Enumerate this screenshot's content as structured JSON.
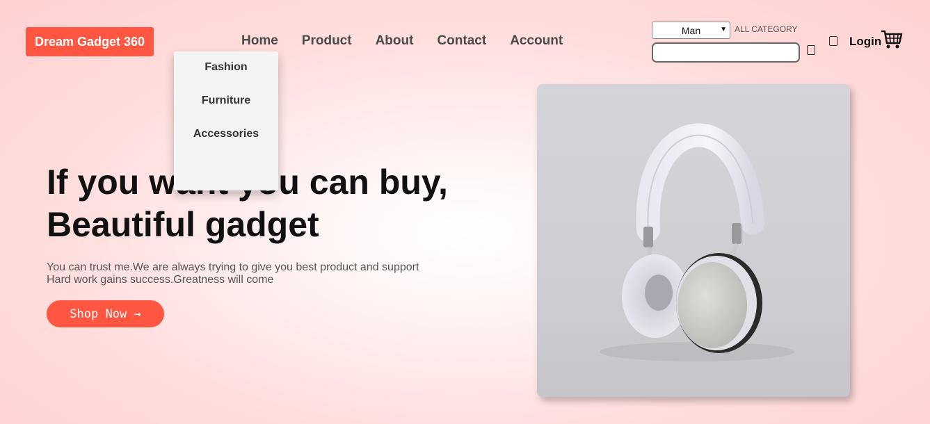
{
  "brand": {
    "name": "Dream Gadget 360",
    "color": "#ff5641"
  },
  "nav": {
    "items": [
      {
        "label": "Home"
      },
      {
        "label": "Product"
      },
      {
        "label": "About"
      },
      {
        "label": "Contact"
      },
      {
        "label": "Account"
      }
    ]
  },
  "dropdown": {
    "items": [
      {
        "label": "Fashion"
      },
      {
        "label": "Furniture"
      },
      {
        "label": "Accessories"
      }
    ]
  },
  "search": {
    "category_selected": "Man",
    "category_label": "ALL CATEGORY",
    "query": "",
    "icon": "search-icon"
  },
  "header_right": {
    "user_icon": "user-icon",
    "login_label": "Login",
    "cart_icon": "cart-icon"
  },
  "hero": {
    "title_line1": "If you want you can buy,",
    "title_line2": "Beautiful gadget",
    "text_line1": "You can trust me.We are always trying to give you best product and support",
    "text_line2": "Hard work gains success.Greatness will come",
    "button_label": "Shop  Now →"
  },
  "product_image": {
    "subject": "white-and-silver-headphones"
  }
}
